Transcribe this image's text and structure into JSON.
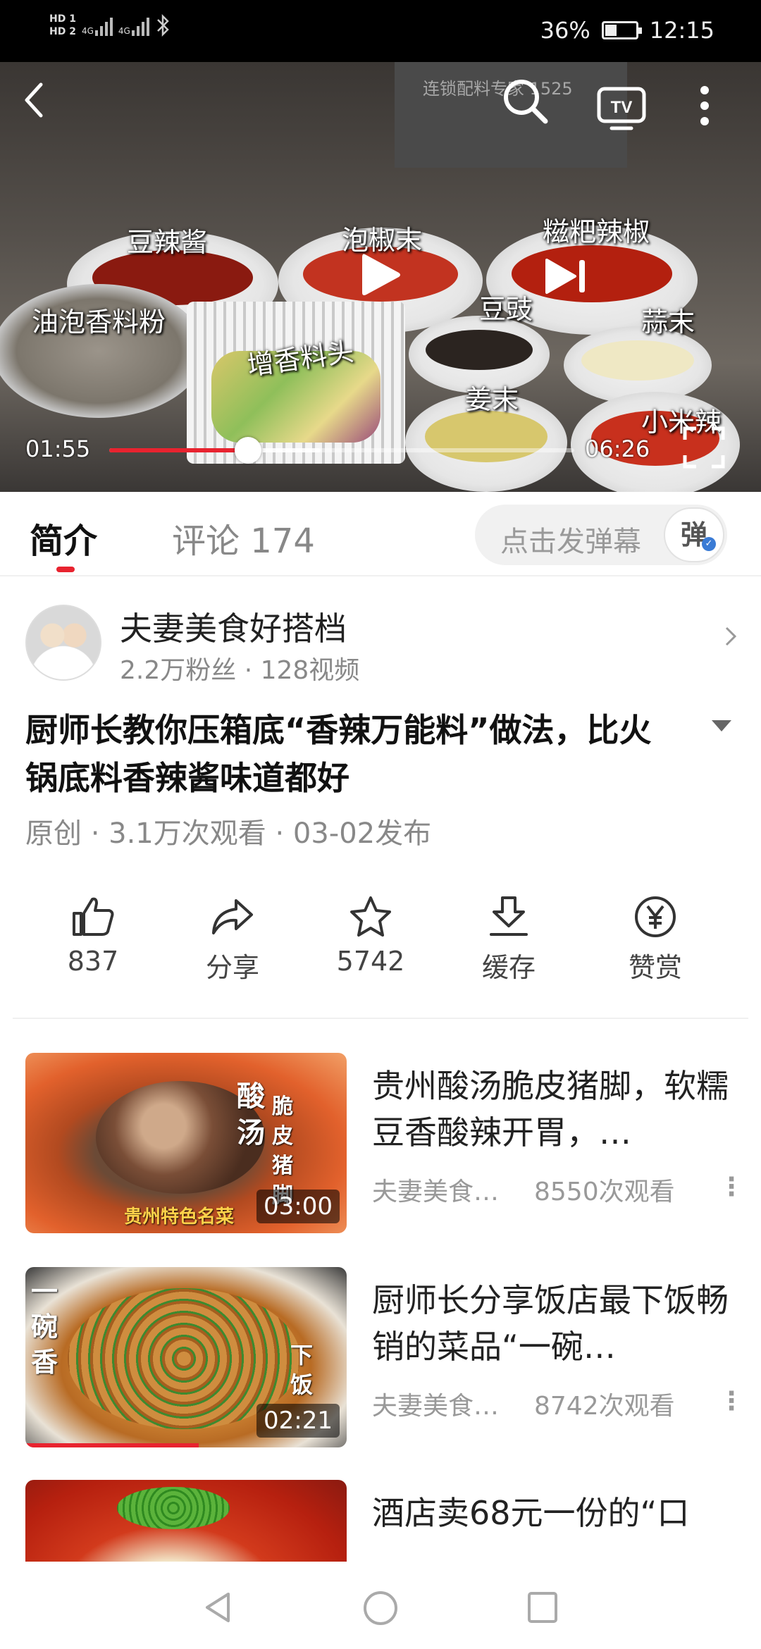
{
  "status_bar": {
    "hd1": "HD 1",
    "hd2": "HD 2",
    "net1": "4G",
    "net2": "4G",
    "battery_percent": "36%",
    "time": "12:15"
  },
  "video": {
    "current_time": "01:55",
    "total_time": "06:26",
    "progress": 0.298,
    "captions": {
      "c1": "豆辣酱",
      "c2": "泡椒末",
      "c3": "糍粑辣椒",
      "c4": "油泡香料粉",
      "c5": "豆豉",
      "c6": "蒜末",
      "c7": "增香料头",
      "c8": "姜末",
      "c9": "小米辣"
    },
    "apron_text": "连锁配料专家 1525"
  },
  "tabs": {
    "intro": "简介",
    "comments": "评论 174",
    "danmaku_placeholder": "点击发弹幕",
    "danmaku_button": "弹"
  },
  "author": {
    "name": "夫妻美食好搭档",
    "stats": "2.2万粉丝 · 128视频"
  },
  "video_info": {
    "title": "厨师长教你压箱底“香辣万能料”做法，比火锅底料香辣酱味道都好",
    "meta": "原创 · 3.1万次观看 · 03-02发布"
  },
  "actions": {
    "like": "837",
    "share": "分享",
    "favorite": "5742",
    "cache": "缓存",
    "reward": "赞赏"
  },
  "recommended": [
    {
      "title": "贵州酸汤脆皮猪脚，软糯豆香酸辣开胃，…",
      "author": "夫妻美食…",
      "views": "8550次观看",
      "duration": "03:00",
      "cap_a": "酸汤",
      "cap_b": "脆皮猪脚",
      "cap_c": "贵州特色名菜",
      "watched": 0
    },
    {
      "title": "厨师长分享饭店最下饭畅销的菜品“一碗…",
      "author": "夫妻美食…",
      "views": "8742次观看",
      "duration": "02:21",
      "cap_a": "一碗香",
      "cap_b": "下饭",
      "watched": 0.54
    },
    {
      "title": "酒店卖68元一份的“口"
    }
  ],
  "colors": {
    "accent": "#e8232f",
    "text_primary": "#222222",
    "text_secondary": "#888888"
  }
}
